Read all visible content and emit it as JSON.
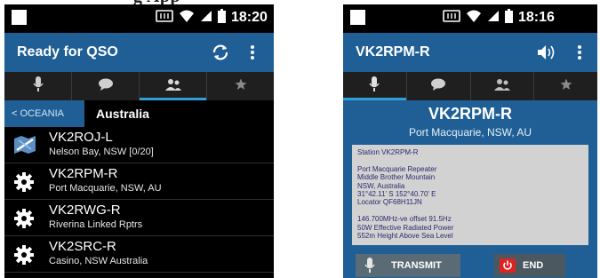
{
  "partial_caption_text": "g App",
  "left": {
    "status": {
      "time": "18:20"
    },
    "title": "Ready for QSO",
    "breadcrumb": {
      "parent": "< OCEANIA",
      "current": "Australia"
    },
    "repeaters": [
      {
        "name": "VK2ROJ-L",
        "desc": "Nelson Bay, NSW [0/20]",
        "icon": "map-link-icon"
      },
      {
        "name": "VK2RPM-R",
        "desc": "Port Macquarie, NSW, AU",
        "icon": "gear-icon"
      },
      {
        "name": "VK2RWG-R",
        "desc": "Riverina Linked Rptrs",
        "icon": "gear-icon"
      },
      {
        "name": "VK2SRC-R",
        "desc": "Casino, NSW Australia",
        "icon": "gear-icon"
      }
    ]
  },
  "right": {
    "status": {
      "time": "18:16"
    },
    "title": "VK2RPM-R",
    "node": {
      "title": "VK2RPM-R",
      "location": "Port Macquarie, NSW, AU",
      "info_lines": [
        "Station VK2RPM-R",
        "",
        "Port Macquarie Repeater",
        "Middle Brother Mountain",
        "NSW, Australia",
        "31°42.11' S 152°40.70' E",
        "Locator QF68H11JN",
        "",
        "146.700MHz-ve offset 91.5Hz",
        "50W Effective Radiated Power",
        "552m Height Above Sea Level"
      ]
    },
    "buttons": {
      "transmit": "TRANSMIT",
      "end": "END"
    }
  },
  "tabs": [
    "microphone-icon",
    "chat-icon",
    "people-icon",
    "star-icon"
  ],
  "colors": {
    "bar": "#1f5f96",
    "accent": "#2f9fd8",
    "end_red": "#dd2222"
  }
}
